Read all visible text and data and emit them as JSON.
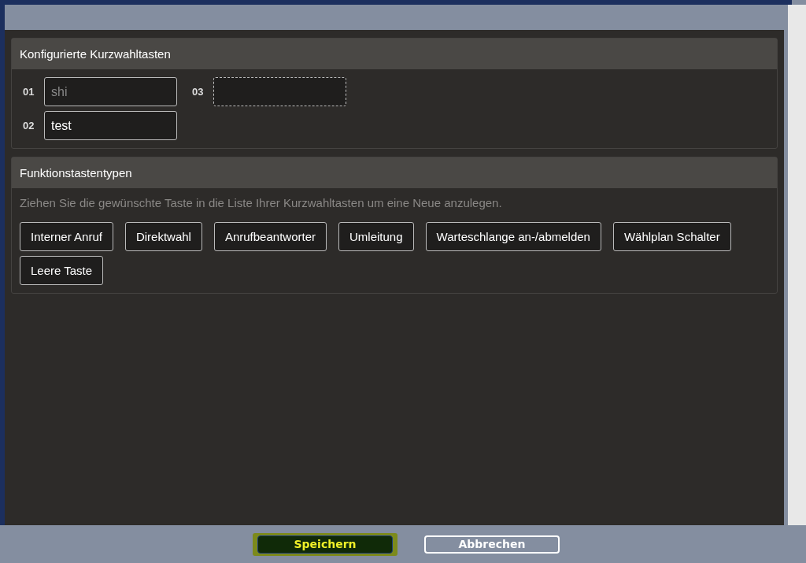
{
  "speed_dial": {
    "title": "Konfigurierte Kurzwahltasten",
    "slots": [
      {
        "number": "01",
        "kind": "field",
        "placeholder": "shi"
      },
      {
        "number": "03",
        "kind": "drop"
      },
      {
        "number": "02",
        "kind": "field",
        "value": "test"
      }
    ]
  },
  "key_types": {
    "title": "Funktionstastentypen",
    "hint": "Ziehen Sie die gewünschte Taste in die Liste Ihrer Kurzwahltasten um eine Neue anzulegen.",
    "keys": [
      "Interner Anruf",
      "Direktwahl",
      "Anrufbeantworter",
      "Umleitung",
      "Warteschlange an-/abmelden",
      "Wählplan Schalter",
      "Leere Taste"
    ]
  },
  "footer": {
    "buttons": [
      {
        "label": "Speichern",
        "kind": "primary",
        "focused": true
      },
      {
        "label": "Abbrechen",
        "kind": "secondary",
        "focused": false
      }
    ]
  }
}
